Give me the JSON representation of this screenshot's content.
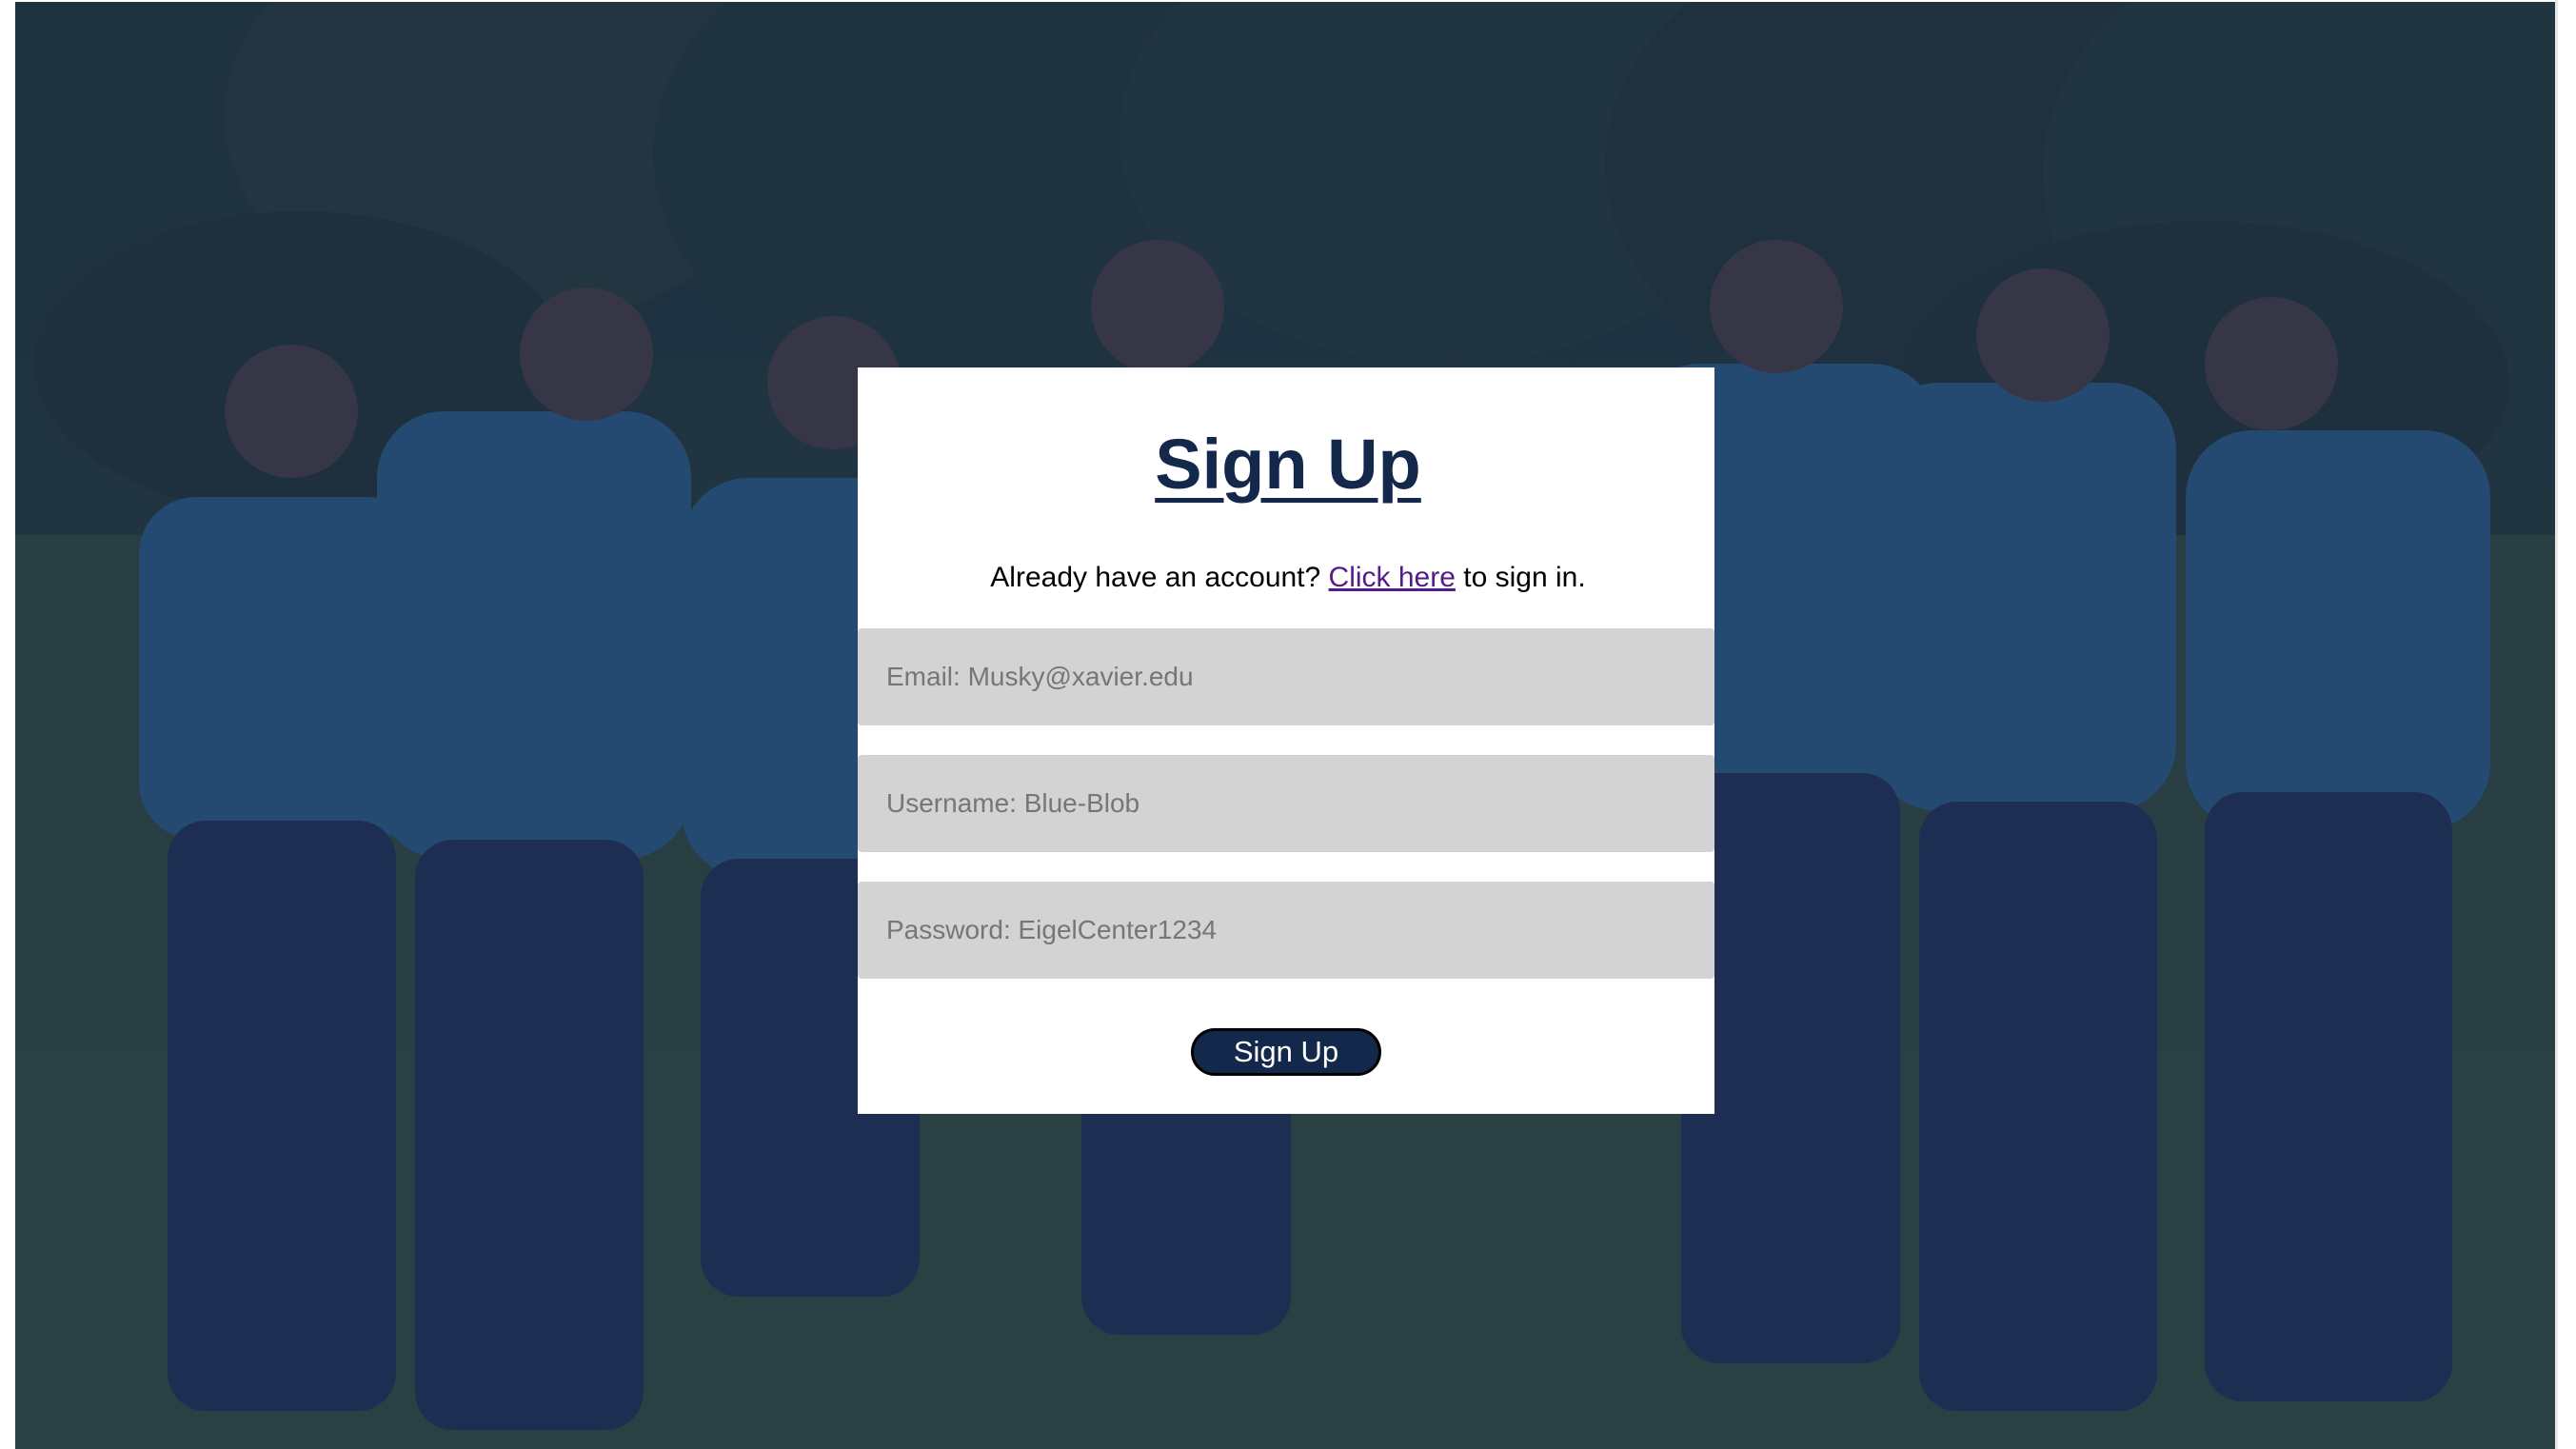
{
  "page": {
    "title": "Sign Up",
    "prompt_prefix": "Already have an account?",
    "signin_link": "Click here",
    "prompt_suffix": "to sign in."
  },
  "form": {
    "email_placeholder": "Email: Musky@xavier.edu",
    "username_placeholder": "Username: Blue-Blob",
    "password_placeholder": "Password: EigelCenter1234",
    "submit_label": "Sign Up"
  },
  "colors": {
    "brand_navy": "#14284b",
    "field_bg": "#d3d3d3",
    "link_visited": "#551a8b",
    "overlay": "rgba(22, 35, 70, 0.62)"
  }
}
